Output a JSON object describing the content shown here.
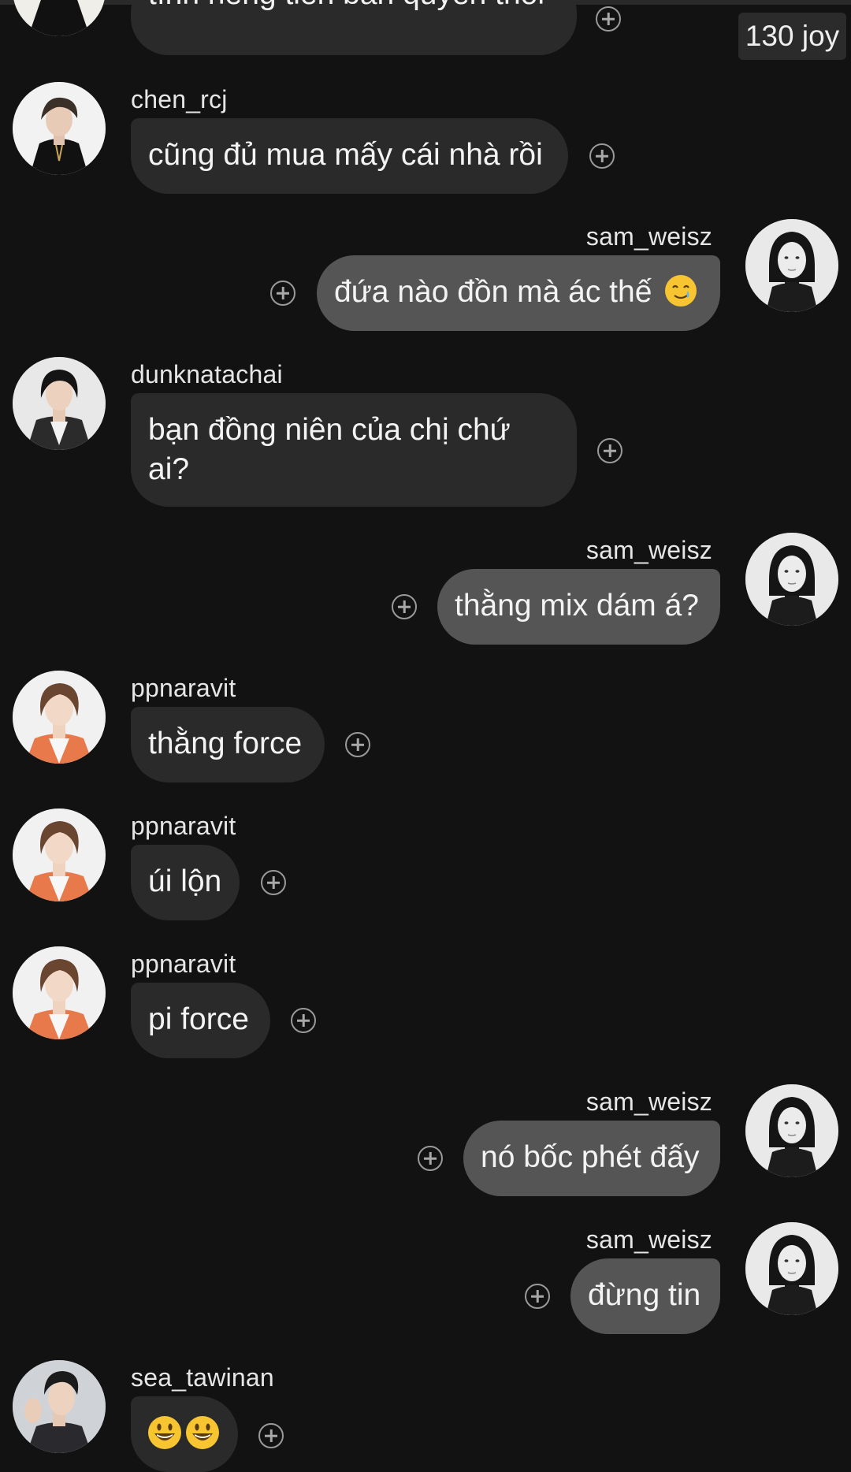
{
  "badge": {
    "label": "130 joy"
  },
  "messages": [
    {
      "user": "",
      "text": "tính riêng tiền bản quyền thôi"
    },
    {
      "user": "chen_rcj",
      "text": "cũng đủ mua mấy cái nhà rồi"
    },
    {
      "user": "sam_weisz",
      "text": "đứa nào đồn mà ác thế",
      "emoji": "smiling-face-with-tear"
    },
    {
      "user": "dunknatachai",
      "text_line1": "bạn đồng niên của chị chứ",
      "text_line2": "ai?"
    },
    {
      "user": "sam_weisz",
      "text": "thằng mix dám á?"
    },
    {
      "user": "ppnaravit",
      "text": "thằng force"
    },
    {
      "user": "ppnaravit",
      "text": "úi lộn"
    },
    {
      "user": "ppnaravit",
      "text": "pi force"
    },
    {
      "user": "sam_weisz",
      "text": "nó bốc phét đấy"
    },
    {
      "user": "sam_weisz",
      "text": "đừng tin"
    },
    {
      "user": "sea_tawinan",
      "text": "",
      "emoji": "grinning-face x2"
    }
  ],
  "icons": {
    "react": "add-reaction-icon"
  },
  "colors": {
    "background": "#121212",
    "bubble_other": "#2a2a2a",
    "bubble_self": "#555555"
  }
}
